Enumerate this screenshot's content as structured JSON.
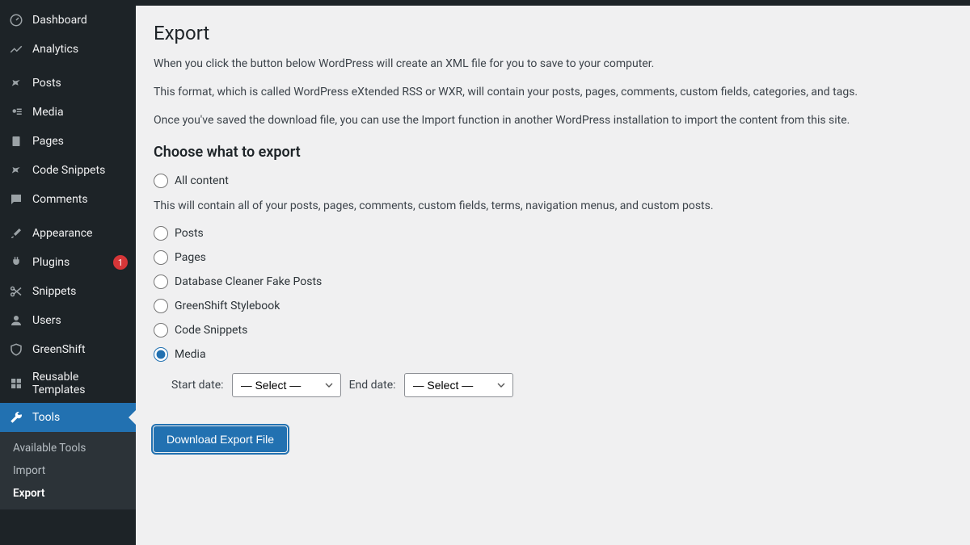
{
  "sidebar": {
    "items": [
      {
        "icon": "dashboard",
        "label": "Dashboard"
      },
      {
        "icon": "analytics",
        "label": "Analytics"
      },
      {
        "icon": "pin",
        "label": "Posts"
      },
      {
        "icon": "media",
        "label": "Media"
      },
      {
        "icon": "page",
        "label": "Pages"
      },
      {
        "icon": "pin",
        "label": "Code Snippets"
      },
      {
        "icon": "comment",
        "label": "Comments"
      },
      {
        "icon": "brush",
        "label": "Appearance"
      },
      {
        "icon": "plug",
        "label": "Plugins",
        "badge": "1"
      },
      {
        "icon": "scissors",
        "label": "Snippets"
      },
      {
        "icon": "user",
        "label": "Users"
      },
      {
        "icon": "shield",
        "label": "GreenShift"
      },
      {
        "icon": "grid",
        "label": "Reusable Templates"
      },
      {
        "icon": "wrench",
        "label": "Tools",
        "active": true
      }
    ],
    "submenu": [
      {
        "label": "Available Tools"
      },
      {
        "label": "Import"
      },
      {
        "label": "Export",
        "current": true
      }
    ]
  },
  "page": {
    "title": "Export",
    "intro1": "When you click the button below WordPress will create an XML file for you to save to your computer.",
    "intro2": "This format, which is called WordPress eXtended RSS or WXR, will contain your posts, pages, comments, custom fields, categories, and tags.",
    "intro3": "Once you've saved the download file, you can use the Import function in another WordPress installation to import the content from this site.",
    "section_heading": "Choose what to export",
    "options": [
      {
        "label": "All content",
        "desc": "This will contain all of your posts, pages, comments, custom fields, terms, navigation menus, and custom posts."
      },
      {
        "label": "Posts"
      },
      {
        "label": "Pages"
      },
      {
        "label": "Database Cleaner Fake Posts"
      },
      {
        "label": "GreenShift Stylebook"
      },
      {
        "label": "Code Snippets"
      },
      {
        "label": "Media",
        "selected": true
      }
    ],
    "date_filter": {
      "start_label": "Start date:",
      "end_label": "End date:",
      "placeholder": "— Select —"
    },
    "button": "Download Export File"
  }
}
